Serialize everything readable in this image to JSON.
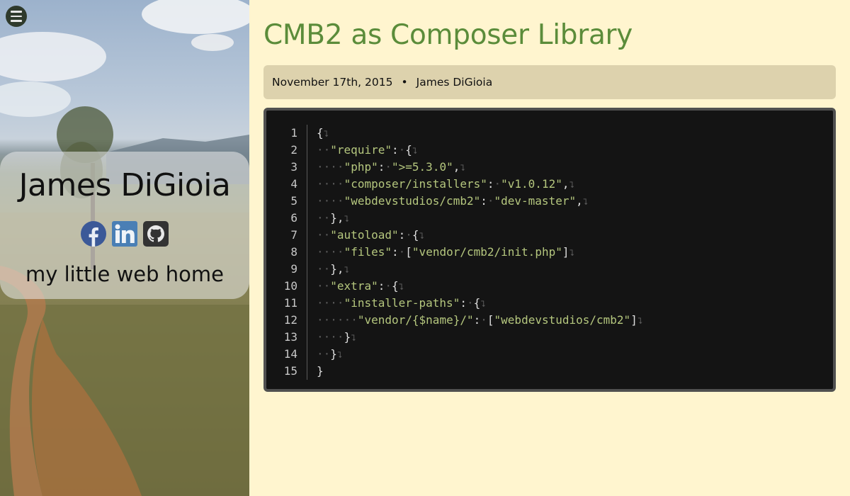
{
  "sidebar": {
    "menu_icon": "hamburger-menu-icon",
    "name": "James DiGioia",
    "social": [
      {
        "icon": "facebook-icon",
        "color": "#3b5998"
      },
      {
        "icon": "linkedin-icon",
        "color": "#4a7fb5"
      },
      {
        "icon": "github-icon",
        "color": "#333333"
      }
    ],
    "tagline": "my little web home"
  },
  "post": {
    "title": "CMB2 as Composer Library",
    "date": "November 17th, 2015",
    "separator": "•",
    "author": "James DiGioia"
  },
  "code": {
    "line_numbers": [
      "1",
      "2",
      "3",
      "4",
      "5",
      "6",
      "7",
      "8",
      "9",
      "10",
      "11",
      "12",
      "13",
      "14",
      "15"
    ],
    "lines": [
      "{",
      "  \"require\": {",
      "    \"php\": \">=5.3.0\",",
      "    \"composer/installers\": \"v1.0.12\",",
      "    \"webdevstudios/cmb2\": \"dev-master\",",
      "  },",
      "  \"autoload\": {",
      "    \"files\": [\"vendor/cmb2/init.php\"]",
      "  },",
      "  \"extra\": {",
      "    \"installer-paths\": {",
      "      \"vendor/{$name}/\": [\"webdevstudios/cmb2\"]",
      "    }",
      "  }",
      "}"
    ]
  },
  "colors": {
    "page_bg": "#fff5cf",
    "title": "#5b8c3a",
    "meta_bg": "#ddd2ad",
    "code_bg": "#141414",
    "code_string": "#b5c77e"
  }
}
